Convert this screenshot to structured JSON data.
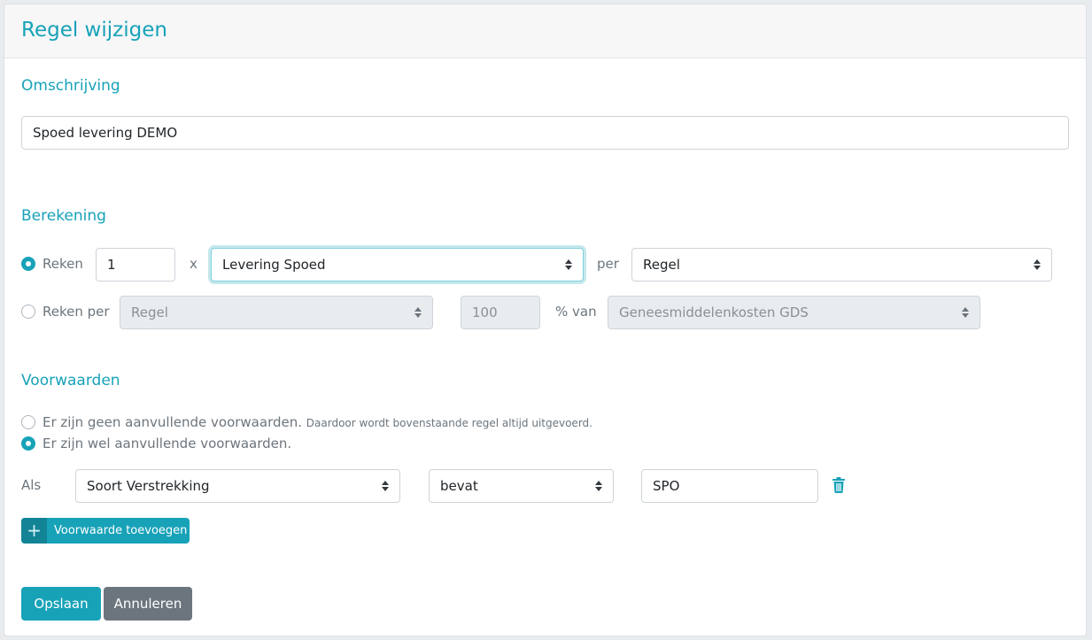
{
  "header": {
    "title": "Regel wijzigen"
  },
  "omschrijving": {
    "title": "Omschrijving",
    "value": "Spoed levering DEMO"
  },
  "berekening": {
    "title": "Berekening",
    "option1": {
      "label": "Reken",
      "checked": true,
      "quantity": "1",
      "times": "x",
      "product": "Levering Spoed",
      "per": "per",
      "unit": "Regel"
    },
    "option2": {
      "label": "Reken per",
      "checked": false,
      "unit": "Regel",
      "percentage": "100",
      "percent_of": "% van",
      "base": "Geneesmiddelenkosten GDS"
    }
  },
  "voorwaarden": {
    "title": "Voorwaarden",
    "option_none": {
      "label": "Er zijn geen aanvullende voorwaarden.",
      "note": "Daardoor wordt bovenstaande regel altijd uitgevoerd.",
      "checked": false
    },
    "option_some": {
      "label": "Er zijn wel aanvullende voorwaarden.",
      "checked": true
    },
    "condition": {
      "prefix": "Als",
      "field": "Soort Verstrekking",
      "operator": "bevat",
      "value": "SPO",
      "delete_icon": "trash-icon"
    },
    "add_button": {
      "icon": "plus-icon",
      "label": "Voorwaarde toevoegen"
    }
  },
  "actions": {
    "save_label": "Opslaan",
    "cancel_label": "Annuleren"
  },
  "colors": {
    "accent": "#17a2b8",
    "secondary": "#6c757d"
  }
}
